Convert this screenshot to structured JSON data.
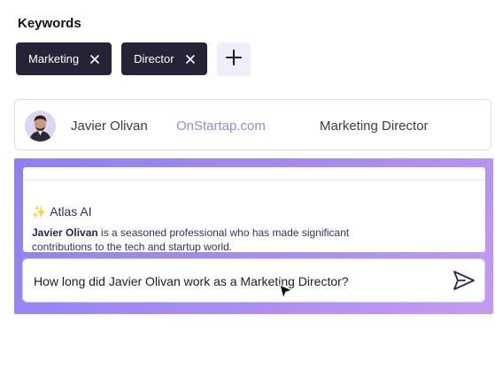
{
  "keywords": {
    "title": "Keywords",
    "chips": [
      {
        "label": "Marketing"
      },
      {
        "label": "Director"
      }
    ],
    "add_icon": "plus-icon"
  },
  "profile": {
    "name": "Javier Olivan",
    "site": "OnStartap.com",
    "title": "Marketing Director"
  },
  "ai": {
    "title": "Atlas AI",
    "icon": "sparkle-icon",
    "summary_name": "Javier Olivan",
    "summary_rest": " is a seasoned professional who has made significant contributions to the tech and startup world.",
    "question": "How long did Javier Olivan work as a Marketing Director?",
    "send_icon": "send-icon"
  },
  "colors": {
    "chip_bg": "#242436",
    "accent": "#9b86e8",
    "panel_gradient_start": "#8d7ff0",
    "panel_gradient_end": "#c49bf3"
  }
}
